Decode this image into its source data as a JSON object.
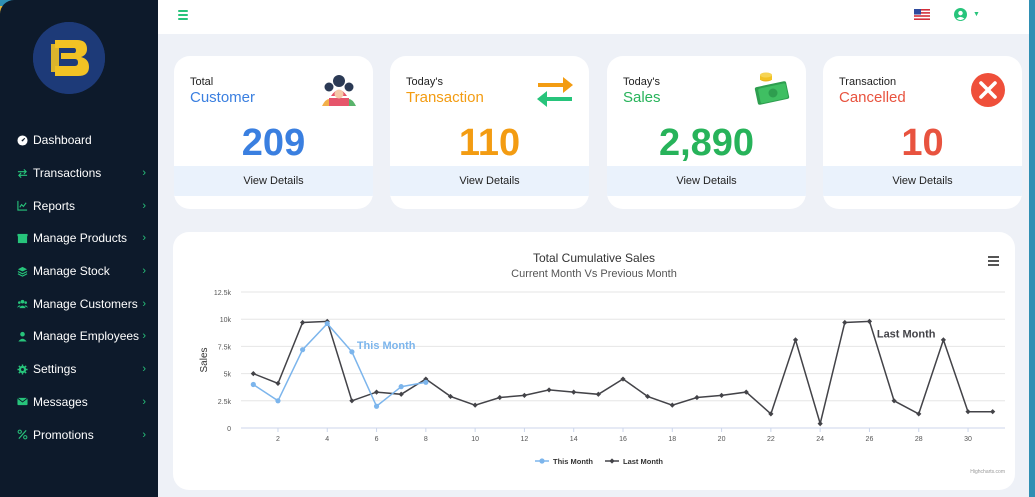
{
  "sidebar": {
    "items": [
      {
        "label": "Dashboard",
        "icon": "dashboard-icon",
        "has_chevron": false
      },
      {
        "label": "Transactions",
        "icon": "exchange-icon",
        "has_chevron": true
      },
      {
        "label": "Reports",
        "icon": "chart-icon",
        "has_chevron": true
      },
      {
        "label": "Manage Products",
        "icon": "box-icon",
        "has_chevron": true
      },
      {
        "label": "Manage Stock",
        "icon": "layers-icon",
        "has_chevron": true
      },
      {
        "label": "Manage Customers",
        "icon": "users-icon",
        "has_chevron": true
      },
      {
        "label": "Manage Employees",
        "icon": "user-tie-icon",
        "has_chevron": true
      },
      {
        "label": "Settings",
        "icon": "gear-icon",
        "has_chevron": true
      },
      {
        "label": "Messages",
        "icon": "envelope-icon",
        "has_chevron": true
      },
      {
        "label": "Promotions",
        "icon": "percent-icon",
        "has_chevron": true
      }
    ],
    "chevron": "›"
  },
  "cards": [
    {
      "label_small": "Total",
      "label_big": "Customer",
      "value": "209",
      "color": "#3a7fe0",
      "icon": "customers-icon",
      "link": "View Details"
    },
    {
      "label_small": "Today's",
      "label_big": "Transaction",
      "value": "110",
      "color": "#f39c12",
      "icon": "transfer-arrows-icon",
      "link": "View Details"
    },
    {
      "label_small": "Today's",
      "label_big": "Sales",
      "value": "2,890",
      "color": "#27b35a",
      "icon": "money-icon",
      "link": "View Details"
    },
    {
      "label_small": "Transaction",
      "label_big": "Cancelled",
      "value": "10",
      "color": "#e8533f",
      "icon": "cancel-icon",
      "link": "View Details"
    }
  ],
  "chart_data": {
    "type": "line",
    "title": "Total Cumulative Sales",
    "subtitle": "Current Month Vs Previous Month",
    "ylabel": "Sales",
    "ylim": [
      0,
      12500
    ],
    "yticks": [
      0,
      2500,
      5000,
      7500,
      10000,
      12500
    ],
    "ytick_labels": [
      "0",
      "2.5k",
      "5k",
      "7.5k",
      "10k",
      "12.5k"
    ],
    "xlim": [
      0.5,
      31.5
    ],
    "xticks": [
      2,
      4,
      6,
      8,
      10,
      12,
      14,
      16,
      18,
      20,
      22,
      24,
      26,
      28,
      30
    ],
    "grid": true,
    "legend_position": "bottom-center",
    "series": [
      {
        "name": "This Month",
        "color": "#7cb5ec",
        "x": [
          1,
          2,
          3,
          4,
          5,
          6,
          7,
          8
        ],
        "values": [
          4000,
          2500,
          7200,
          9600,
          7000,
          2000,
          3800,
          4200
        ],
        "label_text": "This Month"
      },
      {
        "name": "Last Month",
        "color": "#434348",
        "x": [
          1,
          2,
          3,
          4,
          5,
          6,
          7,
          8,
          9,
          10,
          11,
          12,
          13,
          14,
          15,
          16,
          17,
          18,
          19,
          20,
          21,
          22,
          23,
          24,
          25,
          26,
          27,
          28,
          29,
          30,
          31
        ],
        "values": [
          5000,
          4100,
          9700,
          9800,
          2500,
          3300,
          3100,
          4500,
          2900,
          2100,
          2800,
          3000,
          3500,
          3300,
          3100,
          4500,
          2900,
          2100,
          2800,
          3000,
          3300,
          1300,
          8100,
          400,
          9700,
          9800,
          2500,
          1300,
          8100,
          1500,
          1500
        ],
        "label_text": "Last Month"
      }
    ],
    "credit": "Highcharts.com"
  }
}
